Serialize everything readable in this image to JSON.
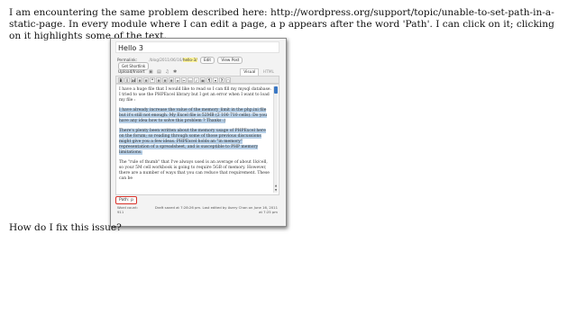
{
  "question": {
    "text": "I am encountering the same problem described here: http://wordpress.org/support/topic/unable-to-set-path-in-a-static-page. In every module where I can edit a page, a p appears after the word 'Path'. I can click on it; clicking on it highlights some of the text.",
    "followup": "How do I fix this issue?"
  },
  "editor": {
    "post_title": "Hello 3",
    "permalink_label": "Permalink:",
    "permalink_url": "/blog/2011/06/16/",
    "permalink_slug": "hello-3/",
    "edit_label": "Edit",
    "view_post_label": "View Post",
    "shortlink_label": "Get Shortlink",
    "upload_label": "Upload/Insert",
    "upload_icons": [
      "▣",
      "▤",
      "♫",
      "✱"
    ],
    "tab_visual": "Visual",
    "tab_html": "HTML",
    "toolbar": [
      "B",
      "I",
      "abc",
      "≡",
      "≡",
      "“",
      "≡",
      "≡",
      "≡",
      "∞",
      "✂",
      "▭",
      "✓",
      "▦",
      "¶",
      "▾",
      "?",
      "▢"
    ],
    "paragraphs": [
      {
        "text": "I have a huge file that I would like to read so I can fill my mysql database. I tried to use the PHPExcel library but I get an error when I want to load my file :",
        "selected": false
      },
      {
        "text": "I have already increase the value of the memory_limit in the php.ini file but it's still not enough. My Excel file is 52MB (2 100 710 cells). Do you have any idea how to solve this problem ? Thanks :)",
        "selected": true
      },
      {
        "text": "There's plenty been written about the memory usage of PHPExcel here on the forum; so reading through some of those previous discussions might give you a few ideas. PHPExcel holds an \"in memory\" representation of a spreadsheet, and is susceptible to PHP memory limitations.",
        "selected": true
      },
      {
        "text": "The \"rule of thumb\" that I've always used is an average of about 1k/cell, so your 5M cell workbook is going to require 5GB of memory. However, there are a number of ways that you can reduce that requirement. These can be",
        "selected": false
      }
    ],
    "path_label": "Path: p",
    "word_count_label": "Word count: 911",
    "saved_status": "Draft saved at 7:28:26 pm. Last edited by Avery Chan on June 16, 2011 at 7:25 pm"
  }
}
